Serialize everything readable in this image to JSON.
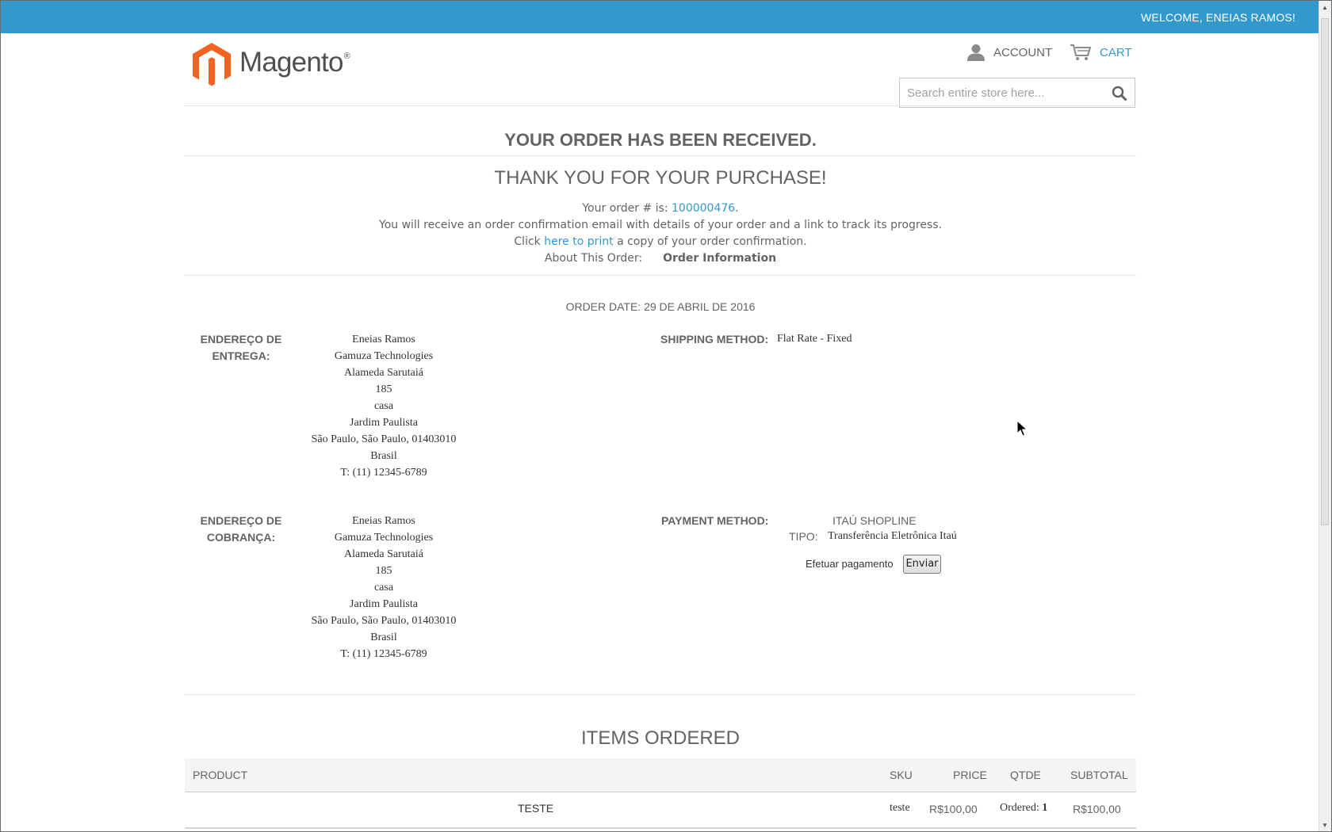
{
  "header": {
    "welcome": "WELCOME, ENEIAS RAMOS!",
    "logo_text": "Magento",
    "logo_reg": "®",
    "account_label": "ACCOUNT",
    "cart_label": "CART",
    "search_placeholder": "Search entire store here..."
  },
  "page": {
    "title": "YOUR ORDER HAS BEEN RECEIVED.",
    "subtitle": "THANK YOU FOR YOUR PURCHASE!",
    "order_prefix": "Your order # is: ",
    "order_number": "100000476",
    "order_suffix": ".",
    "email_note": "You will receive an order confirmation email with details of your order and a link to track its progress.",
    "print_prefix": "Click ",
    "print_link": "here to print",
    "print_suffix": " a copy of your order confirmation.",
    "about_label": "About This Order:",
    "about_value": "Order Information",
    "order_date": "ORDER DATE: 29 DE ABRIL DE 2016"
  },
  "shipping_address": {
    "label_line1": "ENDEREÇO DE",
    "label_line2": "ENTREGA:",
    "lines": [
      "Eneias Ramos",
      "Gamuza Technologies",
      "Alameda Sarutaiá",
      "185",
      "casa",
      "Jardim Paulista",
      "São Paulo, São Paulo, 01403010",
      "Brasil",
      "T: (11) 12345-6789"
    ]
  },
  "billing_address": {
    "label_line1": "ENDEREÇO DE",
    "label_line2": "COBRANÇA:",
    "lines": [
      "Eneias Ramos",
      "Gamuza Technologies",
      "Alameda Sarutaiá",
      "185",
      "casa",
      "Jardim Paulista",
      "São Paulo, São Paulo, 01403010",
      "Brasil",
      "T: (11) 12345-6789"
    ]
  },
  "shipping_method": {
    "label": "SHIPPING METHOD:",
    "value": "Flat Rate - Fixed"
  },
  "payment_method": {
    "label": "PAYMENT METHOD:",
    "name": "ITAÚ SHOPLINE",
    "tipo_label": "TIPO:",
    "tipo_value": "Transferência Eletrônica Itaú",
    "pay_label": "Efetuar pagamento",
    "pay_button": "Enviar"
  },
  "items": {
    "title": "ITEMS ORDERED",
    "headers": [
      "PRODUCT",
      "SKU",
      "PRICE",
      "QTDE",
      "SUBTOTAL"
    ],
    "rows": [
      {
        "product": "TESTE",
        "sku": "teste",
        "price": "R$100,00",
        "qty_label": "Ordered:",
        "qty": "1",
        "subtotal": "R$100,00"
      }
    ]
  },
  "colors": {
    "accent": "#3399cc",
    "logo_orange": "#f26322",
    "text": "#636363"
  }
}
